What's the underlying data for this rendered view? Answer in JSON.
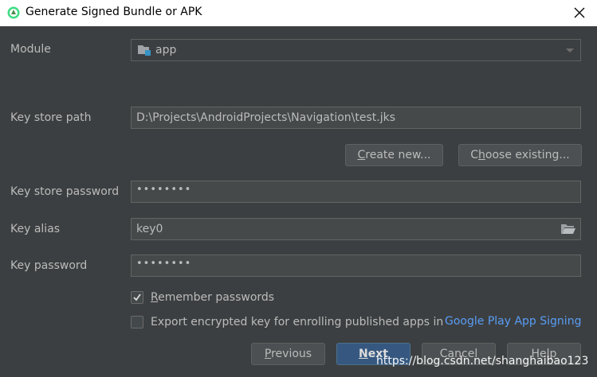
{
  "window": {
    "title": "Generate Signed Bundle or APK",
    "app_icon": "android-studio-icon",
    "close_icon": "close-icon"
  },
  "module": {
    "label": "Module",
    "value": "app",
    "icon": "module-folder-icon"
  },
  "keystore_path": {
    "label": "Key store path",
    "value": "D:\\Projects\\AndroidProjects\\Navigation\\test.jks"
  },
  "buttons": {
    "create_new_u": "C",
    "create_new_rest": "reate new...",
    "choose_existing_pre": "C",
    "choose_existing_u": "h",
    "choose_existing_rest": "oose existing...",
    "previous_u": "P",
    "previous_rest": "revious",
    "next_u": "N",
    "next_rest": "ext",
    "cancel": "Cancel",
    "help": "Help"
  },
  "keystore_password": {
    "label": "Key store password",
    "value": "••••••••"
  },
  "key_alias": {
    "label": "Key alias",
    "value": "key0",
    "icon": "folder-icon"
  },
  "key_password": {
    "label": "Key password",
    "value": "••••••••"
  },
  "remember": {
    "u": "R",
    "rest": "emember passwords",
    "checked": true
  },
  "export": {
    "label": "Export encrypted key for enrolling published apps in",
    "link": "Google Play App Signing",
    "checked": false
  },
  "watermark": "https://blog.csdn.net/shanghaibao123",
  "colors": {
    "background": "#3c3f41",
    "field": "#45494a",
    "primary_button": "#365880",
    "link": "#589df6"
  }
}
